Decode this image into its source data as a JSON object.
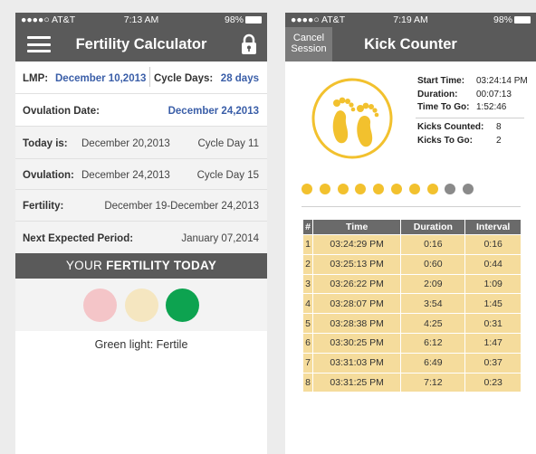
{
  "left_screen": {
    "status": {
      "carrier": "●●●●○ AT&T",
      "time": "7:13 AM",
      "battery": "98%"
    },
    "title": "Fertility Calculator",
    "lmp": {
      "label": "LMP:",
      "value": "December 10,2013"
    },
    "cycle_days": {
      "label": "Cycle Days:",
      "value": "28 days"
    },
    "ovulation_date": {
      "label": "Ovulation Date:",
      "value": "December 24,2013"
    },
    "today": {
      "label": "Today is:",
      "date": "December 20,2013",
      "cycle": "Cycle Day 11"
    },
    "ovulation": {
      "label": "Ovulation:",
      "date": "December 24,2013",
      "cycle": "Cycle Day 15"
    },
    "fertility": {
      "label": "Fertility:",
      "value": "December 19-December 24,2013"
    },
    "next_period": {
      "label": "Next Expected Period:",
      "value": "January 07,2014"
    },
    "banner": {
      "prefix": "YOUR ",
      "bold": "FERTILITY TODAY"
    },
    "lights": [
      "#f4c5c8",
      "#f5e6c0",
      "#0da350"
    ],
    "caption": "Green light: Fertile"
  },
  "right_screen": {
    "status": {
      "carrier": "●●●●○ AT&T",
      "time": "7:19 AM",
      "battery": "98%"
    },
    "cancel": {
      "line1": "Cancel",
      "line2": "Session"
    },
    "title": "Kick Counter",
    "start_time": {
      "label": "Start Time:",
      "value": "03:24:14 PM"
    },
    "duration": {
      "label": "Duration:",
      "value": "00:07:13"
    },
    "time_to_go": {
      "label": "Time To Go:",
      "value": "1:52:46"
    },
    "kicks_counted": {
      "label": "Kicks Counted:",
      "value": "8"
    },
    "kicks_to_go": {
      "label": "Kicks To Go:",
      "value": "2"
    },
    "dots_filled": 8,
    "dots_total": 10,
    "colors": {
      "accent": "#f2c12e",
      "inactive": "#8a8a8a"
    },
    "table": {
      "headers": [
        "#",
        "Time",
        "Duration",
        "Interval"
      ],
      "rows": [
        [
          "1",
          "03:24:29 PM",
          "0:16",
          "0:16"
        ],
        [
          "2",
          "03:25:13 PM",
          "0:60",
          "0:44"
        ],
        [
          "3",
          "03:26:22 PM",
          "2:09",
          "1:09"
        ],
        [
          "4",
          "03:28:07 PM",
          "3:54",
          "1:45"
        ],
        [
          "5",
          "03:28:38 PM",
          "4:25",
          "0:31"
        ],
        [
          "6",
          "03:30:25 PM",
          "6:12",
          "1:47"
        ],
        [
          "7",
          "03:31:03 PM",
          "6:49",
          "0:37"
        ],
        [
          "8",
          "03:31:25 PM",
          "7:12",
          "0:23"
        ]
      ]
    }
  }
}
